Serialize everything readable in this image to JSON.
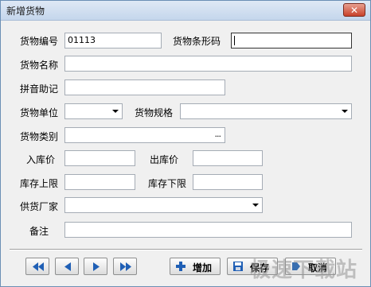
{
  "window": {
    "title": "新增货物",
    "close_glyph": "✕"
  },
  "form": {
    "code_label": "货物编号",
    "code_value": "01113",
    "barcode_label": "货物条形码",
    "barcode_value": "",
    "name_label": "货物名称",
    "name_value": "",
    "pinyin_label": "拼音助记",
    "pinyin_value": "",
    "unit_label": "货物单位",
    "unit_value": "",
    "spec_label": "货物规格",
    "spec_value": "",
    "category_label": "货物类别",
    "category_value": "",
    "category_browse": "...",
    "in_price_label": "入库价",
    "in_price_value": "",
    "out_price_label": "出库价",
    "out_price_value": "",
    "stock_max_label": "库存上限",
    "stock_max_value": "",
    "stock_min_label": "库存下限",
    "stock_min_value": "",
    "supplier_label": "供货厂家",
    "supplier_value": "",
    "remark_label": "备注",
    "remark_value": ""
  },
  "toolbar": {
    "add_label": "增加",
    "save_label": "保存",
    "cancel_label": "取消",
    "icons": [
      "first-icon",
      "prev-icon",
      "next-icon",
      "last-icon",
      "plus-icon",
      "save-icon",
      "cancel-icon"
    ]
  },
  "watermark": "极速下载站",
  "colors": {
    "accent": "#1f5fb5",
    "close": "#c8412a"
  }
}
